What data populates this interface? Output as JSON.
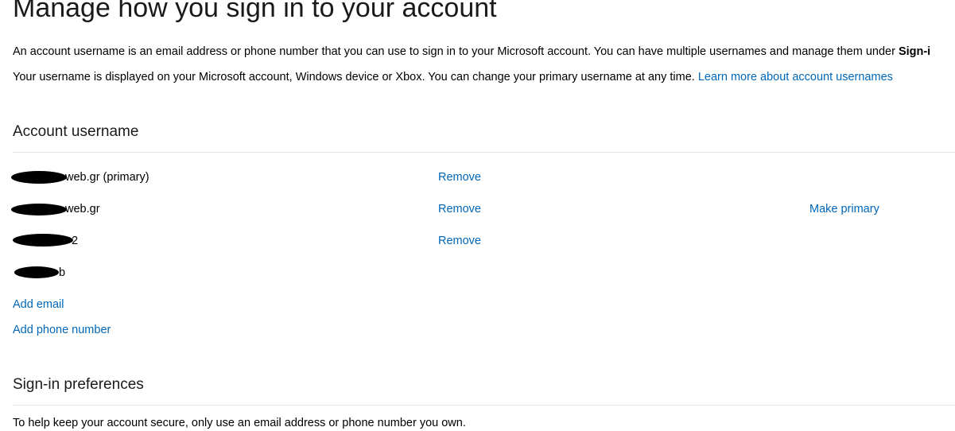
{
  "page": {
    "title": "Manage how you sign in to your account",
    "intro_line1_prefix": "An account username is an email address or phone number that you can use to sign in to your Microsoft account. You can have multiple usernames and manage them under ",
    "intro_line1_bold": "Sign-i",
    "intro_line2": "Your username is displayed on your Microsoft account, Windows device or Xbox. You can change your primary username at any time. ",
    "learn_more_link": "Learn more about account usernames"
  },
  "account_username": {
    "heading": "Account username",
    "rows": [
      {
        "suffix": "web.gr (primary)",
        "remove_label": "Remove",
        "make_primary_label": ""
      },
      {
        "suffix": "web.gr",
        "remove_label": "Remove",
        "make_primary_label": "Make primary"
      },
      {
        "suffix": "2",
        "remove_label": "Remove",
        "make_primary_label": ""
      },
      {
        "suffix": "b",
        "remove_label": "",
        "make_primary_label": ""
      }
    ],
    "add_email": "Add email",
    "add_phone": "Add phone number"
  },
  "signin_preferences": {
    "heading": "Sign-in preferences",
    "text": "To help keep your account secure, only use an email address or phone number you own."
  },
  "colors": {
    "link": "#0067b8",
    "divider": "#e5e5e5",
    "text": "#000000"
  }
}
